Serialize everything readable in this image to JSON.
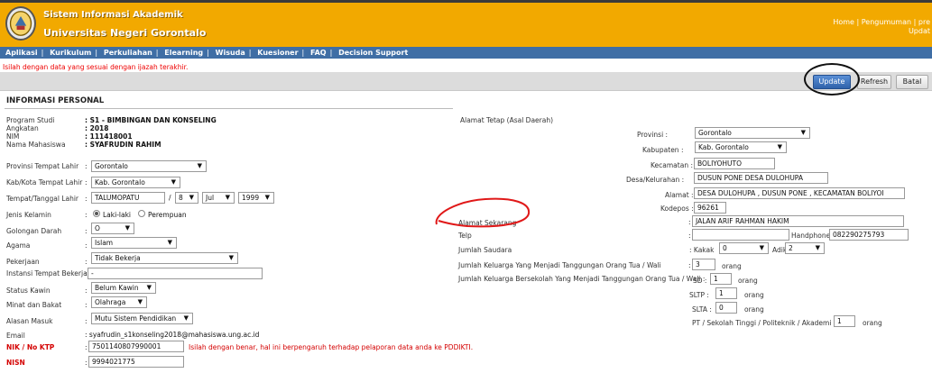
{
  "header": {
    "system_title": "Sistem Informasi Akademik",
    "university": "Universitas Negeri Gorontalo",
    "link_home": "Home",
    "link_sep": "|",
    "link_news": "Pengumuman",
    "link_cut": "pre",
    "sub_cut": "Updat"
  },
  "nav": {
    "items": [
      "Aplikasi",
      "Kurikulum",
      "Perkuliahan",
      "Elearning",
      "Wisuda",
      "Kuesioner",
      "FAQ",
      "Decision Support"
    ]
  },
  "warning": "Isilah dengan data yang sesuai dengan ijazah terakhir.",
  "toolbar": {
    "update": "Update",
    "refresh": "Refresh",
    "batal": "Batal"
  },
  "section_title": "INFORMASI PERSONAL",
  "left": {
    "program_studi": {
      "label": "Program Studi",
      "value": ": S1 - BIMBINGAN DAN KONSELING"
    },
    "angkatan": {
      "label": "Angkatan",
      "value": ": 2018"
    },
    "nim": {
      "label": "NIM",
      "value": ": 111418001"
    },
    "nama": {
      "label": "Nama Mahasiswa",
      "value": ": SYAFRUDIN RAHIM"
    },
    "prov_lahir": {
      "label": "Provinsi Tempat Lahir",
      "value": "Gorontalo"
    },
    "kab_lahir": {
      "label": "Kab/Kota Tempat Lahir",
      "value": "Kab. Gorontalo"
    },
    "ttl": {
      "label": "Tempat/Tanggal Lahir",
      "place": "TALUMOPATU",
      "slash": "/",
      "day": "8",
      "month": "Jul",
      "year": "1999"
    },
    "gender": {
      "label": "Jenis Kelamin",
      "opt1": "Laki-laki",
      "opt2": "Perempuan"
    },
    "goldar": {
      "label": "Golongan Darah",
      "value": "O"
    },
    "agama": {
      "label": "Agama",
      "value": "Islam"
    },
    "pekerjaan": {
      "label": "Pekerjaan",
      "value": "Tidak Bekerja"
    },
    "instansi": {
      "label": "Instansi Tempat Bekerja",
      "value": "-"
    },
    "kawin": {
      "label": "Status Kawin",
      "value": "Belum Kawin"
    },
    "minat": {
      "label": "Minat dan Bakat",
      "value": "Olahraga"
    },
    "alasan": {
      "label": "Alasan Masuk",
      "value": "Mutu Sistem Pendidikan"
    },
    "email": {
      "label": "Email",
      "value": ": syafrudin_s1konseling2018@mahasiswa.ung.ac.id"
    },
    "nik": {
      "label": "NIK / No KTP",
      "value": "7501140807990001",
      "note": "Isilah dengan benar, hal ini berpengaruh terhadap pelaporan data anda ke PDDIKTI."
    },
    "nisn": {
      "label": "NISN",
      "value": "9994021775"
    },
    "colon": ":"
  },
  "right": {
    "alamat_tetap": "Alamat Tetap (Asal Daerah)",
    "provinsi": {
      "label": "Provinsi :",
      "value": "Gorontalo"
    },
    "kabupaten": {
      "label": "Kabupaten :",
      "value": "Kab. Gorontalo"
    },
    "kecamatan": {
      "label": "Kecamatan :",
      "value": "BOLIYOHUTO"
    },
    "desa": {
      "label": "Desa/Kelurahan :",
      "value": "DUSUN PONE DESA DULOHUPA"
    },
    "alamat": {
      "label": "Alamat :",
      "value": "DESA DULOHUPA , DUSUN PONE , KECAMATAN BOLIYOI"
    },
    "kodepos": {
      "label": "Kodepos :",
      "value": "96261"
    },
    "alamat_sekarang": {
      "label": "Alamat Sekarang",
      "value": "JALAN ARIF RAHMAN HAKIM"
    },
    "telp": {
      "label": "Telp",
      "value": ""
    },
    "handphone": {
      "label": "Handphone",
      "value": "082290275793"
    },
    "saudara": {
      "label": "Jumlah Saudara",
      "kakak_label": ": Kakak",
      "kakak": "0",
      "adik_label": "Adik",
      "adik": "2"
    },
    "tanggungan": {
      "label": "Jumlah Keluarga Yang Menjadi Tanggungan Orang Tua / Wali",
      "value": "3",
      "unit": "orang"
    },
    "sekolah": {
      "label": "Jumlah Keluarga Bersekolah Yang Menjadi Tanggungan Orang Tua / Wali :",
      "sd_label": "SD :",
      "sd": "1",
      "sltp_label": "SLTP :",
      "sltp": "1",
      "slta_label": "SLTA :",
      "slta": "0",
      "pt_label": "PT / Sekolah Tinggi / Politeknik / Akademi :",
      "pt": "1",
      "unit": "orang"
    },
    "colon": ":"
  }
}
